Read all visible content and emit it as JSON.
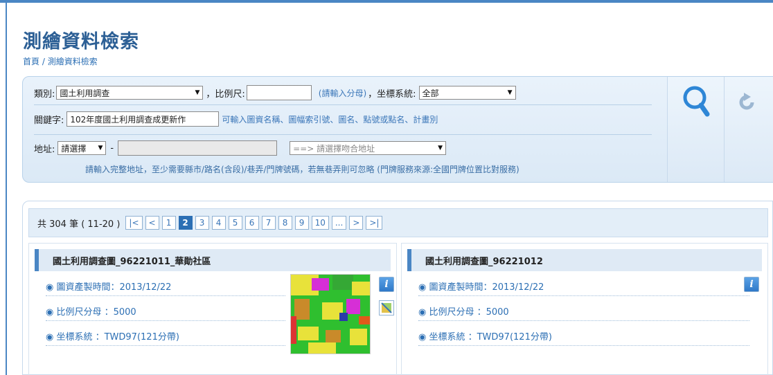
{
  "page": {
    "title": "測繪資料檢索"
  },
  "breadcrumb": {
    "home": "首頁",
    "separator": " / ",
    "current": "測繪資料檢索"
  },
  "search": {
    "category_label": "類別:",
    "category_value": "國土利用調查",
    "scale_label": "，比例尺:",
    "scale_value": "",
    "scale_hint": "(請輸入分母)",
    "crs_label": "，坐標系統:",
    "crs_value": "全部",
    "keyword_label": "關鍵字:",
    "keyword_value": "102年度國土利用調查成更新作",
    "keyword_hint": "可輸入圖資名稱、圖幅索引號、圖名、點號或點名、計畫別",
    "address_label": "地址:",
    "address_select": "請選擇",
    "address_dash": "-",
    "address_input": "",
    "address_match": "==> 請選擇吻合地址",
    "address_note": "請輸入完整地址，至少需要縣市/路名(含段)/巷弄/門牌號碼，若無巷弄則可忽略 (門牌服務來源:全國門牌位置比對服務)",
    "search_icon": "magnifier-icon",
    "reset_icon": "reset-icon"
  },
  "results": {
    "count_text": "共 304 筆 ( 11-20 )",
    "pager": [
      "|<",
      "<",
      "1",
      "2",
      "3",
      "4",
      "5",
      "6",
      "7",
      "8",
      "9",
      "10",
      "...",
      ">",
      ">|"
    ],
    "active_page": "2",
    "cards": [
      {
        "title": "國土利用調查圖_96221011_華勛社區",
        "date": "◉ 圖資產製時間：2013/12/22",
        "scale": "◉ 比例尺分母 ：5000",
        "crs": "◉ 坐標系統 ：TWD97(121分帶)"
      },
      {
        "title": "國土利用調查圖_96221012",
        "date": "◉ 圖資產製時間：2013/12/22",
        "scale": "◉ 比例尺分母 ：5000",
        "crs": "◉ 坐標系統 ：TWD97(121分帶)"
      }
    ],
    "info_icon": "i"
  },
  "colors": {
    "accent": "#2c6fb4",
    "panel": "#dbe9f6",
    "active_page": "#2c6fb4"
  }
}
